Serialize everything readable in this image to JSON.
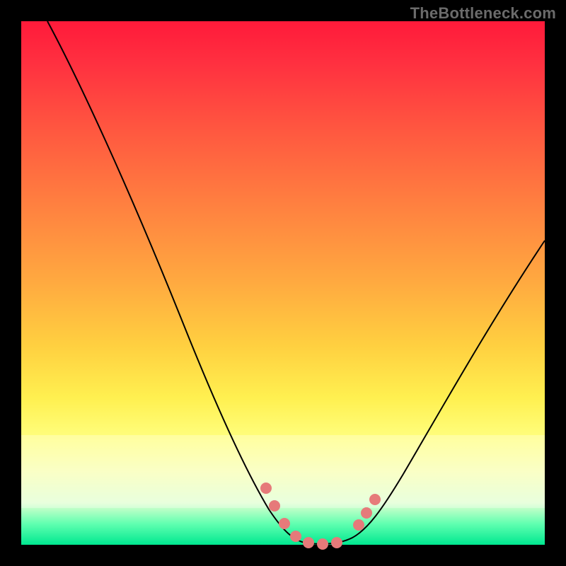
{
  "watermark": {
    "text": "TheBottleneck.com"
  },
  "chart_data": {
    "type": "line",
    "title": "",
    "xlabel": "",
    "ylabel": "",
    "xlim": [
      0,
      100
    ],
    "ylim": [
      0,
      100
    ],
    "grid": false,
    "legend": false,
    "series": [
      {
        "name": "bottleneck-curve",
        "x": [
          5,
          10,
          15,
          20,
          25,
          30,
          35,
          40,
          45,
          48,
          50,
          53,
          56,
          60,
          62,
          66,
          70,
          78,
          86,
          94,
          100
        ],
        "values": [
          100,
          90,
          80,
          70,
          60,
          50,
          40,
          30,
          18,
          10,
          4,
          1,
          0,
          0,
          1,
          4,
          10,
          22,
          35,
          48,
          58
        ]
      }
    ],
    "markers": {
      "name": "highlight-points",
      "x": [
        47,
        49,
        51.5,
        54,
        57,
        60,
        63,
        65,
        66.5,
        68
      ],
      "values": [
        11,
        6,
        3,
        1,
        0,
        0,
        2,
        4,
        6,
        9
      ]
    },
    "colors": {
      "gradient_top": "#ff1a3a",
      "gradient_mid": "#ffd040",
      "gradient_bottom": "#00e890",
      "curve": "#000000",
      "marker": "#e67a7a"
    }
  }
}
